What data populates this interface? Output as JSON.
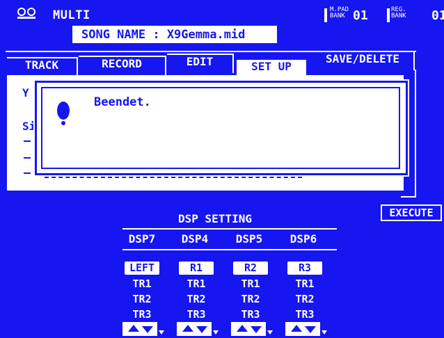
{
  "top_bar": {
    "mode": "MULTI",
    "mpad": {
      "small_top": "M.PAD",
      "small_bottom": "BANK",
      "number": "01"
    },
    "reg": {
      "small_top": "REG.",
      "small_bottom": "BANK",
      "number": "01"
    }
  },
  "song": {
    "label": "SONG NAME : X9Gemma.mid"
  },
  "tabs": [
    {
      "label": "TRACK"
    },
    {
      "label": "RECORD"
    },
    {
      "label": "EDIT"
    },
    {
      "label": "SET UP",
      "active": true
    },
    {
      "label": "SAVE/DELETE"
    }
  ],
  "panel": {
    "frag_si": "Si",
    "frag_y": "Y"
  },
  "dialog": {
    "message": "Beendet."
  },
  "execute_label": "EXECUTE",
  "dsp": {
    "title": "DSP SETTING",
    "columns": [
      {
        "name": "DSP7",
        "value": "LEFT",
        "tracks": [
          "TR1",
          "TR2",
          "TR3"
        ]
      },
      {
        "name": "DSP4",
        "value": "R1",
        "tracks": [
          "TR1",
          "TR2",
          "TR3"
        ]
      },
      {
        "name": "DSP5",
        "value": "R2",
        "tracks": [
          "TR1",
          "TR2",
          "TR3"
        ]
      },
      {
        "name": "DSP6",
        "value": "R3",
        "tracks": [
          "TR1",
          "TR2",
          "TR3"
        ]
      }
    ]
  },
  "colors": {
    "lcd_blue": "#1616f0",
    "lcd_white": "#ffffff"
  }
}
